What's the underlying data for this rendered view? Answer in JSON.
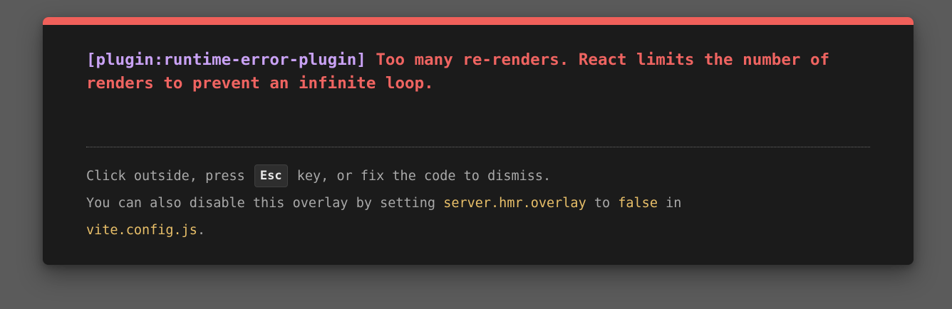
{
  "error_overlay": {
    "plugin_label": "[plugin:runtime-error-plugin]",
    "message": "Too many re-renders. React limits the number of renders to prevent an infinite loop.",
    "tip": {
      "line1_before": "Click outside, press ",
      "key": "Esc",
      "line1_after": " key, or fix the code to dismiss.",
      "line2_before": "You can also disable this overlay by setting ",
      "config_option": "server.hmr.overlay",
      "line2_mid": " to ",
      "value": "false",
      "line2_after": " in",
      "config_file": "vite.config.js",
      "line3_after": "."
    },
    "colors": {
      "backdrop": "#5b5b5b",
      "panel": "#1b1b1b",
      "accent_bar": "#f0605a",
      "plugin": "#c9a2f5",
      "error_message": "#ef6461",
      "tip_text": "#a9a9a9",
      "code": "#e8bf69"
    }
  }
}
